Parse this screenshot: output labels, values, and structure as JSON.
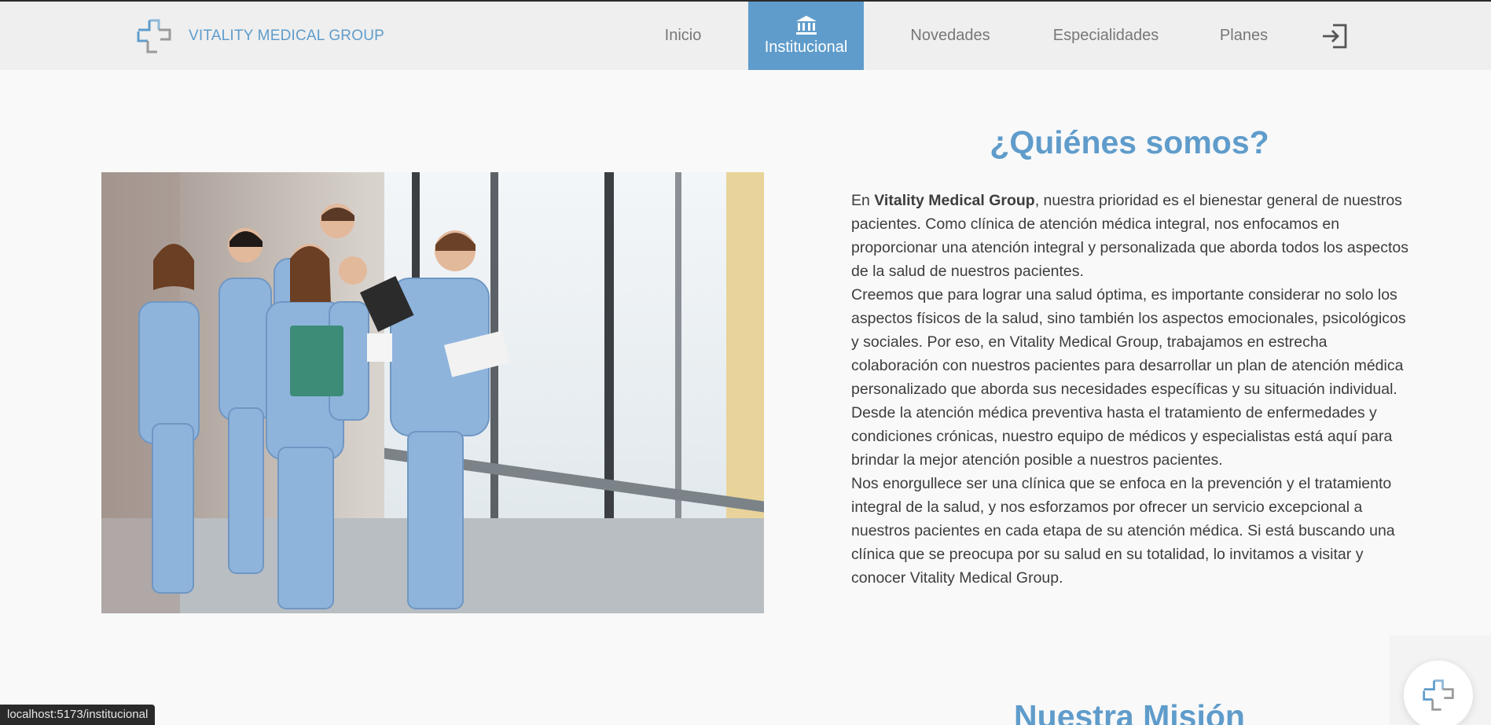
{
  "brand": {
    "name": "VITALITY MEDICAL GROUP",
    "logo_icon": "medical-cross-logo-icon"
  },
  "nav": {
    "items": [
      {
        "label": "Inicio"
      },
      {
        "label": "Institucional",
        "icon": "bank-icon",
        "active": true
      },
      {
        "label": "Novedades"
      },
      {
        "label": "Especialidades"
      },
      {
        "label": "Planes"
      }
    ],
    "login_icon": "login-icon"
  },
  "about": {
    "title": "¿Quiénes somos?",
    "p1_prefix": "En ",
    "p1_bold": "Vitality Medical Group",
    "p1_rest": ", nuestra prioridad es el bienestar general de nuestros pacientes. Como clínica de atención médica integral, nos enfocamos en proporcionar una atención integral y personalizada que aborda todos los aspectos de la salud de nuestros pacientes.",
    "p2": "Creemos que para lograr una salud óptima, es importante considerar no solo los aspectos físicos de la salud, sino también los aspectos emocionales, psicológicos y sociales. Por eso, en Vitality Medical Group, trabajamos en estrecha colaboración con nuestros pacientes para desarrollar un plan de atención médica personalizado que aborda sus necesidades específicas y su situación individual. Desde la atención médica preventiva hasta el tratamiento de enfermedades y condiciones crónicas, nuestro equipo de médicos y especialistas está aquí para brindar la mejor atención posible a nuestros pacientes.",
    "p3": "Nos enorgullece ser una clínica que se enfoca en la prevención y el tratamiento integral de la salud, y nos esforzamos por ofrecer un servicio excepcional a nuestros pacientes en cada etapa de su atención médica. Si está buscando una clínica que se preocupa por su salud en su totalidad, lo invitamos a visitar y conocer Vitality Medical Group."
  },
  "mission": {
    "title": "Nuestra Misión"
  },
  "status_bar": {
    "url": "localhost:5173/institucional"
  },
  "colors": {
    "accent": "#5f9ccb",
    "header_bg": "#efefef",
    "page_bg": "#f9f9f9"
  }
}
